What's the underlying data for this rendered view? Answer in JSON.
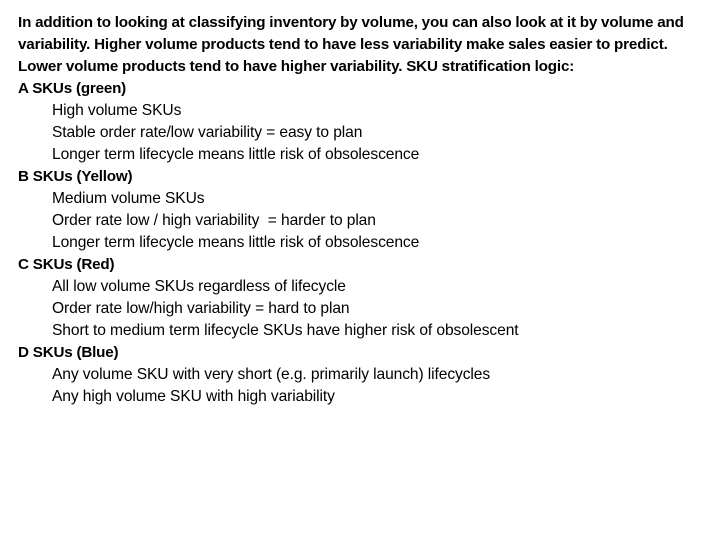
{
  "slide": {
    "intro_paragraph": "In addition to looking at classifying inventory by volume, you can also look at it by volume and variability. Higher volume products tend to have less variability make sales easier to predict. Lower volume products tend to have higher variability. SKU stratification logic:",
    "groups": [
      {
        "heading": "A SKUs (green)",
        "color_name": "green",
        "items": [
          "High volume SKUs",
          "Stable order rate/low variability = easy to plan",
          "Longer term lifecycle means little risk of obsolescence"
        ]
      },
      {
        "heading": "B SKUs (Yellow)",
        "color_name": "Yellow",
        "items": [
          "Medium volume SKUs",
          "Order rate low / high variability  = harder to plan",
          "Longer term lifecycle means little risk of obsolescence"
        ]
      },
      {
        "heading": "C SKUs (Red)",
        "color_name": "Red",
        "items": [
          "All low volume SKUs regardless of lifecycle",
          "Order rate low/high variability = hard to plan",
          "Short to medium term lifecycle SKUs have higher risk of obsolescent"
        ]
      },
      {
        "heading": "D SKUs (Blue)",
        "color_name": "Blue",
        "items": [
          "Any volume SKU with very short (e.g. primarily launch) lifecycles",
          "Any high volume SKU with high variability"
        ]
      }
    ]
  }
}
